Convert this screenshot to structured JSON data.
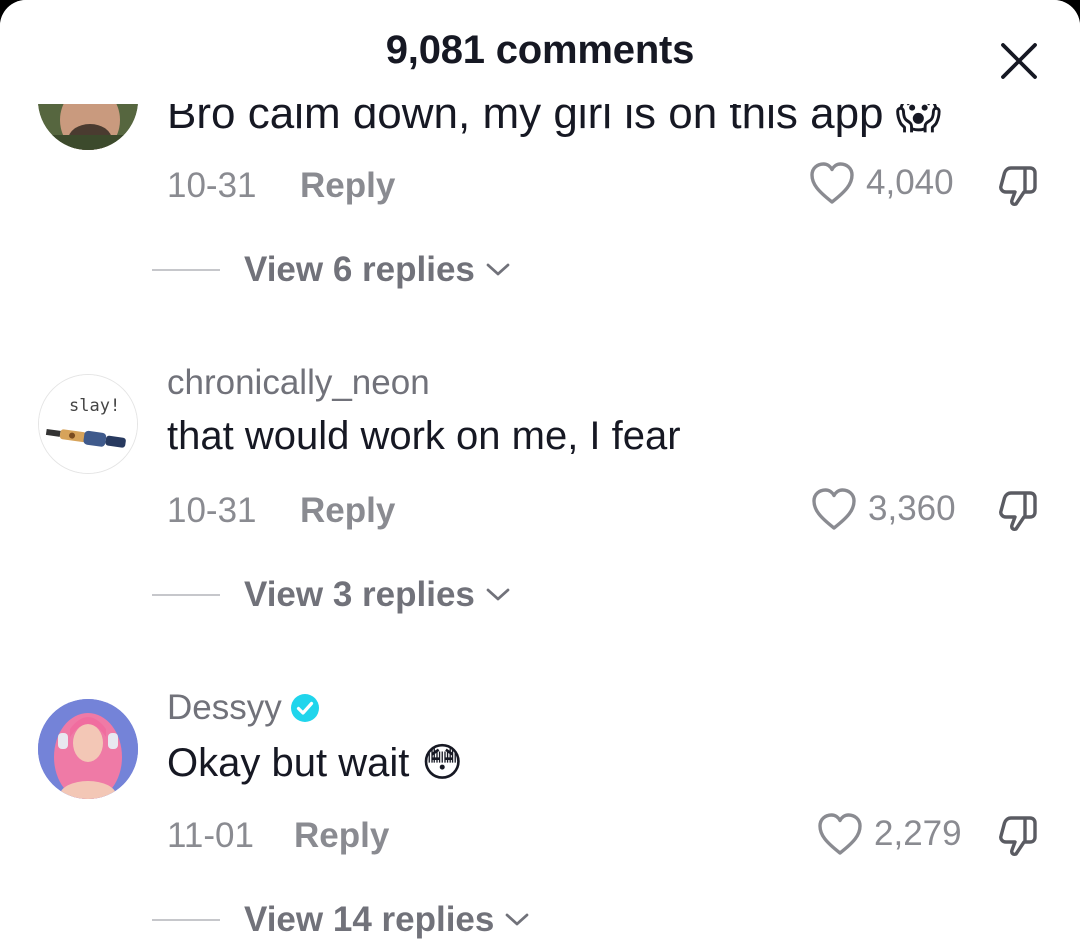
{
  "header": {
    "title": "9,081 comments"
  },
  "comments": [
    {
      "username": "",
      "text": "Bro calm down, my girl is on this app",
      "emoji": "😱",
      "date": "10-31",
      "reply_label": "Reply",
      "likes": "4,040",
      "view_replies": "View 6 replies",
      "verified": false
    },
    {
      "username": "chronically_neon",
      "text": "that would work on me, I fear",
      "emoji": "",
      "date": "10-31",
      "reply_label": "Reply",
      "likes": "3,360",
      "view_replies": "View 3 replies",
      "avatar_text": "slay!",
      "verified": false
    },
    {
      "username": "Dessyy",
      "text": "Okay but wait",
      "emoji": "😳",
      "date": "11-01",
      "reply_label": "Reply",
      "likes": "2,279",
      "view_replies": "View 14 replies",
      "verified": true
    }
  ],
  "colors": {
    "verified": "#20D5EC",
    "text": "#161823",
    "secondary": "#8a8b91"
  },
  "icons": [
    "close-icon",
    "heart-icon",
    "dislike-icon",
    "chevron-down-icon",
    "verified-badge-icon"
  ]
}
